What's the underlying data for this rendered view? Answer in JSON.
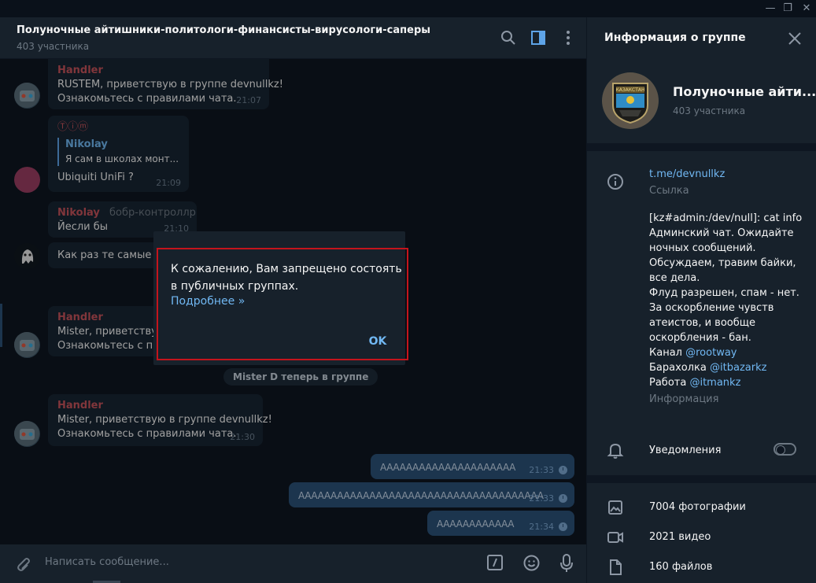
{
  "window": {
    "minimize": "—",
    "maximize": "❐",
    "close": "✕"
  },
  "chat": {
    "title": "Полуночные айтишники-политологи-финансисты-вирусологи-саперы",
    "members": "403 участника"
  },
  "messages": {
    "m1": {
      "sender": "Handler",
      "line1": "RUSTEM, приветствую в группе devnullkz!",
      "line2": "Ознакомьтесь с правилами чата.",
      "time": "21:07"
    },
    "m2": {
      "sender": "Ⓣⓘⓜ",
      "quote_name": "Nikolay",
      "quote_text": "Я сам в школах монт...",
      "text": "Ubiquiti UniFi ?",
      "time": "21:09"
    },
    "m3": {
      "sender": "Nikolay",
      "badge": "бобр-контроллр",
      "text": "Йесли бы",
      "time": "21:10"
    },
    "m4": {
      "text": "Как раз те самые дл"
    },
    "m5": {
      "sender": "Handler",
      "line1": "Mister, приветствую",
      "line2": "Ознакомьтесь с пра"
    },
    "service": "Mister D теперь в группе",
    "m6": {
      "sender": "Handler",
      "line1": "Mister, приветствую в группе devnullkz!",
      "line2": "Ознакомьтесь с правилами чата.",
      "time": "21:30"
    },
    "o1": {
      "text": "ААААААААААААААААААААА",
      "time": "21:33"
    },
    "o2": {
      "text": "АААААААААААААААААААААААААААААААААААААА",
      "time": "21:33"
    },
    "o3": {
      "text": "АААААААААААА",
      "time": "21:34"
    }
  },
  "composer": {
    "placeholder": "Написать сообщение..."
  },
  "dialog": {
    "text": "К сожалению, Вам запрещено состоять в публичных группах.",
    "link": "Подробнее »",
    "ok": "OK"
  },
  "info": {
    "title": "Информация о группе",
    "group_name": "Полуночные айти...",
    "members": "403 участника",
    "link": "t.me/devnullkz",
    "link_caption": "Ссылка",
    "desc_lines": [
      "[kz#admin:/dev/null]: cat info",
      "Админский чат. Ожидайте",
      "ночных сообщений.",
      "Обсуждаем, травим байки,",
      "все дела.",
      "Флуд разрешен, спам - нет.",
      "За оскорбление чувств",
      "атеистов, и вообще",
      "оскорбления - бан."
    ],
    "channel_label": "Канал",
    "channel_handle": "@rootway",
    "market_label": "Барахолка",
    "market_handle": "@itbazarkz",
    "work_label": "Работа",
    "work_handle": "@itmankz",
    "desc_caption": "Информация",
    "notifications": "Уведомления",
    "photos": "7004 фотографии",
    "videos": "2021 видео",
    "files": "160 файлов",
    "avatar_text": "КАЗАКСТАН"
  },
  "colors": {
    "sender": "#c6535b",
    "link": "#71b8f3",
    "outgoing": "#2b5278",
    "highlight": "#c4141c"
  }
}
